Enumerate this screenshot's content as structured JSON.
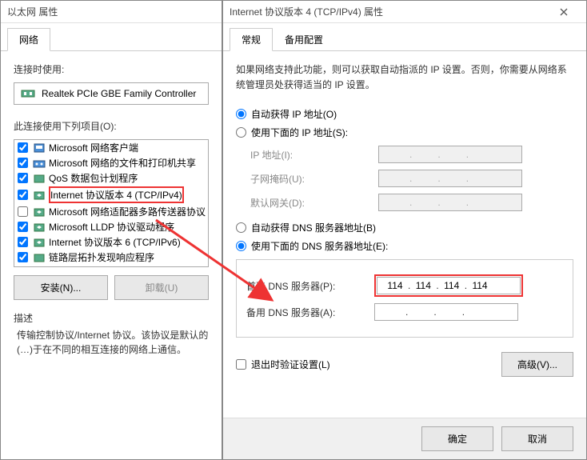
{
  "left": {
    "title": "以太网 属性",
    "tab_network": "网络",
    "connect_using_label": "连接时使用:",
    "adapter": "Realtek PCIe GBE Family Controller",
    "items_label": "此连接使用下列项目(O):",
    "items": [
      {
        "label": "Microsoft 网络客户端",
        "checked": true,
        "icon": "client"
      },
      {
        "label": "Microsoft 网络的文件和打印机共享",
        "checked": true,
        "icon": "share"
      },
      {
        "label": "QoS 数据包计划程序",
        "checked": true,
        "icon": "qos"
      },
      {
        "label": "Internet 协议版本 4 (TCP/IPv4)",
        "checked": true,
        "icon": "proto",
        "highlight": true
      },
      {
        "label": "Microsoft 网络适配器多路传送器协议",
        "checked": false,
        "icon": "proto"
      },
      {
        "label": "Microsoft LLDP 协议驱动程序",
        "checked": true,
        "icon": "proto"
      },
      {
        "label": "Internet 协议版本 6 (TCP/IPv6)",
        "checked": true,
        "icon": "proto"
      },
      {
        "label": "链路层拓扑发现响应程序",
        "checked": true,
        "icon": "lltd"
      }
    ],
    "install_btn": "安装(N)...",
    "uninstall_btn": "卸载(U)",
    "desc_title": "描述",
    "desc_text": "传输控制协议/Internet 协议。该协议是默认的(…)于在不同的相互连接的网络上通信。"
  },
  "right": {
    "title": "Internet 协议版本 4 (TCP/IPv4) 属性",
    "tab_general": "常规",
    "tab_alt": "备用配置",
    "info": "如果网络支持此功能，则可以获取自动指派的 IP 设置。否则，你需要从网络系统管理员处获得适当的 IP 设置。",
    "ip_auto": "自动获得 IP 地址(O)",
    "ip_manual": "使用下面的 IP 地址(S):",
    "ip_addr_label": "IP 地址(I):",
    "subnet_label": "子网掩码(U):",
    "gateway_label": "默认网关(D):",
    "dns_auto": "自动获得 DNS 服务器地址(B)",
    "dns_manual": "使用下面的 DNS 服务器地址(E):",
    "dns_primary_label": "首选 DNS 服务器(P):",
    "dns_primary": [
      "114",
      "114",
      "114",
      "114"
    ],
    "dns_alt_label": "备用 DNS 服务器(A):",
    "validate_label": "退出时验证设置(L)",
    "advanced_btn": "高级(V)...",
    "ok_btn": "确定",
    "cancel_btn": "取消"
  }
}
